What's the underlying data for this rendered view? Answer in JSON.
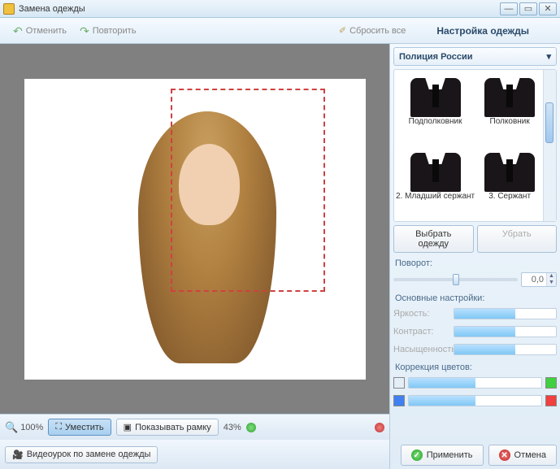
{
  "window": {
    "title": "Замена одежды"
  },
  "toolbar": {
    "undo": "Отменить",
    "redo": "Повторить",
    "reset_all": "Сбросить все"
  },
  "side_title": "Настройка одежды",
  "category": {
    "label": "Полиция России"
  },
  "catalog": [
    {
      "label": "Подполковник"
    },
    {
      "label": "Полковник"
    },
    {
      "label": "2. Младший сержант"
    },
    {
      "label": "3. Сержант"
    }
  ],
  "buttons": {
    "choose": "Выбрать одежду",
    "remove": "Убрать",
    "apply": "Применить",
    "cancel": "Отмена"
  },
  "rotate": {
    "label": "Поворот:",
    "value": "0,0"
  },
  "adjust": {
    "title": "Основные настройки:",
    "brightness": "Яркость:",
    "contrast": "Контраст:",
    "saturation": "Насыщенность:"
  },
  "color": {
    "title": "Коррекция цветов:",
    "swatches": [
      "#e050e0",
      "#40d040",
      "#4080f0",
      "#f04040"
    ]
  },
  "zoom": {
    "percent": "100%",
    "fit": "Уместить",
    "show_frame": "Показывать рамку",
    "percent2": "43%"
  },
  "video_lesson": "Видеоурок по замене одежды"
}
